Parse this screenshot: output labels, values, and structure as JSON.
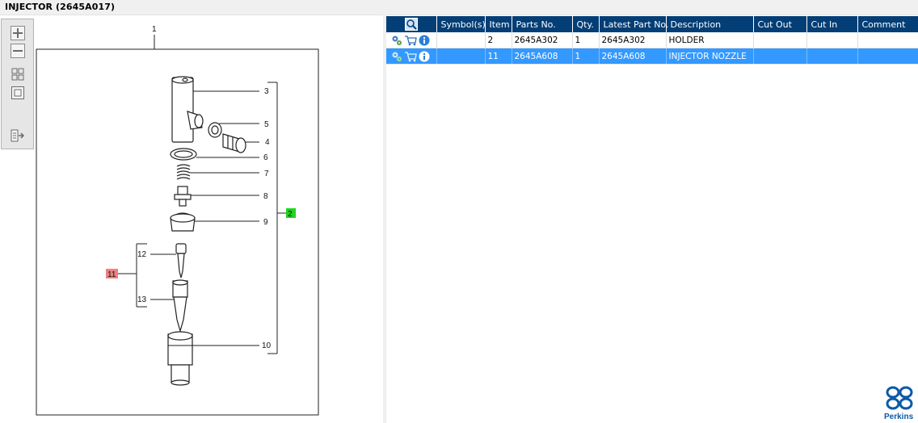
{
  "window": {
    "title": "INJECTOR (2645A017)"
  },
  "toolbar": {
    "buttons": [
      {
        "name": "zoom-in",
        "icon": "plus-icon"
      },
      {
        "name": "zoom-out",
        "icon": "minus-icon"
      },
      {
        "name": "fit-window",
        "icon": "fit-icon"
      },
      {
        "name": "actual-size",
        "icon": "square-icon"
      },
      {
        "name": "export",
        "icon": "export-icon"
      }
    ]
  },
  "drawing": {
    "callouts": [
      "1",
      "3",
      "5",
      "4",
      "6",
      "7",
      "8",
      "9",
      "10",
      "12",
      "13"
    ],
    "highlighted": {
      "green": "2",
      "red": "11"
    },
    "colors": {
      "green": "#1fd51f",
      "red": "#f08080"
    }
  },
  "parts_table": {
    "columns": [
      "",
      "Symbol(s)",
      "Item",
      "Parts No.",
      "Qty.",
      "Latest Part No.",
      "Description",
      "Cut Out",
      "Cut In",
      "Comment"
    ],
    "rows": [
      {
        "symbols": "",
        "item": "2",
        "part_no": "2645A302",
        "qty": "1",
        "latest_part_no": "2645A302",
        "description": "HOLDER",
        "cut_out": "",
        "cut_in": "",
        "comment": "",
        "selected": false
      },
      {
        "symbols": "",
        "item": "11",
        "part_no": "2645A608",
        "qty": "1",
        "latest_part_no": "2645A608",
        "description": "INJECTOR NOZZLE",
        "cut_out": "",
        "cut_in": "",
        "comment": "",
        "selected": true
      }
    ],
    "header_color": "#033e76",
    "selected_color": "#3399ff"
  },
  "brand": {
    "name": "Perkins",
    "color": "#0b5aa8"
  }
}
